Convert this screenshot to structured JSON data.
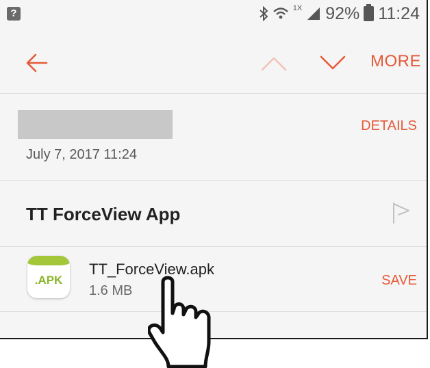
{
  "status_bar": {
    "notification_icon": "?",
    "network_label": "1X",
    "battery": "92%",
    "time": "11:24"
  },
  "toolbar": {
    "more_label": "MORE",
    "icons": [
      "back-arrow-icon",
      "chevron-up-icon",
      "chevron-down-icon"
    ]
  },
  "message": {
    "date": "July 7, 2017  11:24",
    "details_label": "DETAILS",
    "subject": "TT ForceView App"
  },
  "attachment": {
    "badge": ".APK",
    "file_name": "TT_ForceView.apk",
    "file_size": "1.6 MB",
    "save_label": "SAVE"
  },
  "colors": {
    "accent": "#e55a3a",
    "accent_disabled": "#f3c1b4",
    "apk_green": "#a4c639"
  }
}
